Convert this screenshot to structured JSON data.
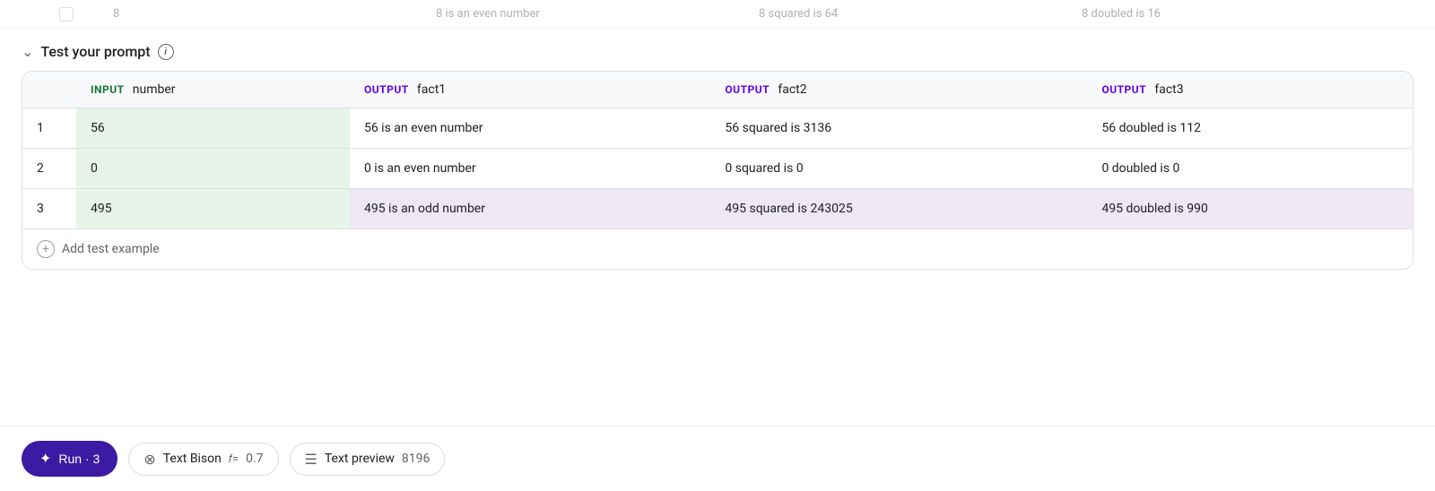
{
  "topRow": {
    "checkbox": "",
    "number": "8",
    "fact1": "8 is an even number",
    "fact2": "8 squared is 64",
    "fact3": "8 doubled is 16"
  },
  "section": {
    "title": "Test your prompt",
    "infoLabel": "i"
  },
  "table": {
    "headers": {
      "rowNum": "",
      "inputLabel": "INPUT",
      "inputName": "number",
      "output1Label": "OUTPUT",
      "output1Name": "fact1",
      "output2Label": "OUTPUT",
      "output2Name": "fact2",
      "output3Label": "OUTPUT",
      "output3Name": "fact3"
    },
    "rows": [
      {
        "num": "1",
        "input": "56",
        "fact1": "56 is an even number",
        "fact2": "56 squared is 3136",
        "fact3": "56 doubled is 112"
      },
      {
        "num": "2",
        "input": "0",
        "fact1": "0 is an even number",
        "fact2": "0 squared is 0",
        "fact3": "0 doubled is 0"
      },
      {
        "num": "3",
        "input": "495",
        "fact1": "495 is an odd number",
        "fact2": "495 squared is 243025",
        "fact3": "495 doubled is 990"
      }
    ],
    "addExampleLabel": "Add test example"
  },
  "toolbar": {
    "runLabel": "Run · 3",
    "modelName": "Text Bison",
    "modelTemp": "0.7",
    "previewLabel": "Text preview",
    "previewValue": "8196"
  }
}
